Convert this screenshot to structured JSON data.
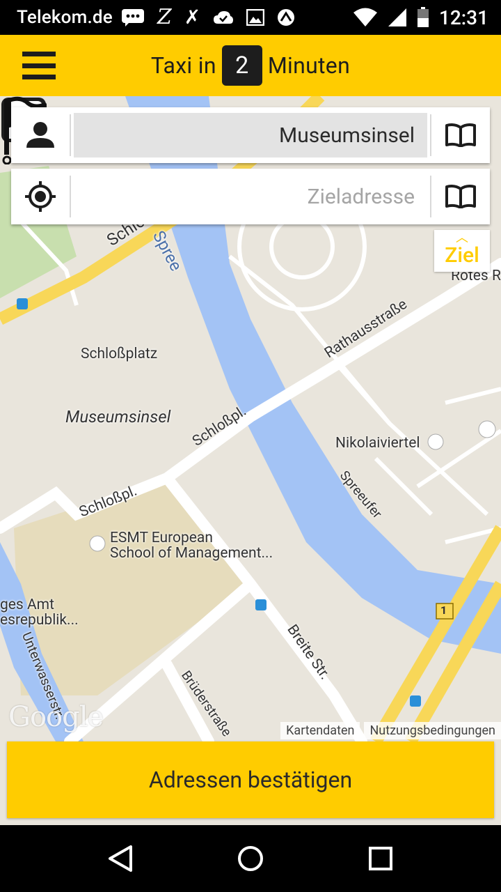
{
  "status_bar": {
    "carrier": "Telekom.de",
    "time": "12:31",
    "icons": [
      "message-icon",
      "z-icon",
      "xing-icon",
      "cloud-icon",
      "image-icon",
      "app-icon",
      "wifi-icon",
      "signal-icon",
      "battery-icon"
    ]
  },
  "app_bar": {
    "title_prefix": "Taxi in",
    "minutes": "2",
    "title_suffix": "Minuten"
  },
  "pickup": {
    "value": "Museumsinsel",
    "icon": "person-icon",
    "trail_icon": "address-book-icon"
  },
  "destination": {
    "placeholder": "Zieladresse",
    "icon": "location-target-icon",
    "trail_icon": "address-book-icon"
  },
  "ziel_button": {
    "label": "Ziel"
  },
  "map": {
    "labels": {
      "schlossplatz": "Schloßplatz",
      "schlosspl_top": "Schloßpl.",
      "spree": "Spree",
      "rathausstrasse": "Rathausstraße",
      "rotes": "Rotes R",
      "nikolaiviertel": "Nikolaiviertel",
      "spreeufer": "Spreeufer",
      "schlosspl_mid": "Schloßpl.",
      "schlosspl_low": "Schloßpl.",
      "esmt_1": "ESMT European",
      "esmt_2": "School of Management...",
      "amt_1": "ges Amt",
      "amt_2": "esrepublik...",
      "unterwasser": "Unterwasserstr.",
      "breite": "Breite Str.",
      "bruder": "Brüderstraße",
      "road_number": "1"
    },
    "pin_label": "Museumsinsel",
    "google": "Google",
    "footer_data": "Kartendaten",
    "footer_terms": "Nutzungsbedingungen"
  },
  "confirm_button": {
    "label": "Adressen bestätigen"
  },
  "nav": {
    "back": "back-icon",
    "home": "home-icon",
    "recents": "recents-icon"
  },
  "colors": {
    "accent": "#ffcc00",
    "dark": "#1d1d1d",
    "water": "#a3c3f5",
    "map_bg": "#e9e5dc",
    "road_major": "#f8d758"
  }
}
